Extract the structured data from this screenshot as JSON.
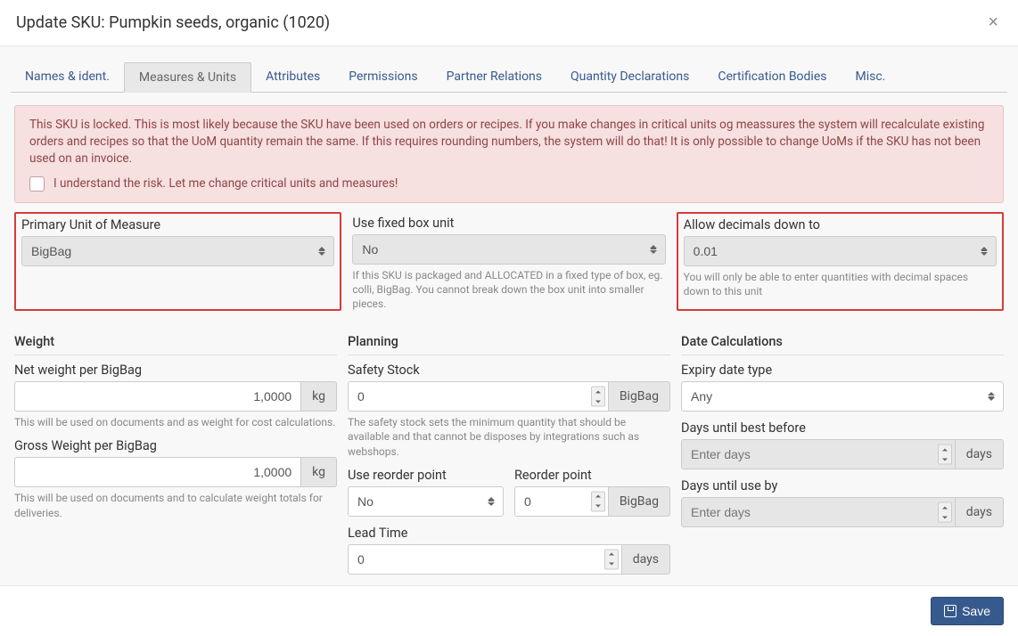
{
  "header": {
    "title": "Update SKU: Pumpkin seeds, organic (1020)"
  },
  "tabs": [
    "Names & ident.",
    "Measures & Units",
    "Attributes",
    "Permissions",
    "Partner Relations",
    "Quantity Declarations",
    "Certification Bodies",
    "Misc."
  ],
  "alert": {
    "text": "This SKU is locked. This is most likely because the SKU have been used on orders or recipes. If you make changes in critical units og meassures the system will recalculate existing orders and recipes so that the UoM quantity remain the same. If this requires rounding numbers, the system will do that! It is only possible to change UoMs if the SKU has not been used on an invoice.",
    "checkbox_label": "I understand the risk. Let me change critical units and measures!"
  },
  "primary_uom": {
    "label": "Primary Unit of Measure",
    "value": "BigBag"
  },
  "fixed_box": {
    "label": "Use fixed box unit",
    "value": "No",
    "hint": "If this SKU is packaged and ALLOCATED in a fixed type of box, eg. colli, BigBag. You cannot break down the box unit into smaller pieces."
  },
  "decimals": {
    "label": "Allow decimals down to",
    "value": "0.01",
    "hint": "You will only be able to enter quantities with decimal spaces down to this unit"
  },
  "weight": {
    "section": "Weight",
    "net_label": "Net weight per BigBag",
    "net_value": "1,0000",
    "net_unit": "kg",
    "net_hint": "This will be used on documents and as weight for cost calculations.",
    "gross_label": "Gross Weight per BigBag",
    "gross_value": "1,0000",
    "gross_unit": "kg",
    "gross_hint": "This will be used on documents and to calculate weight totals for deliveries."
  },
  "planning": {
    "section": "Planning",
    "safety_label": "Safety Stock",
    "safety_value": "0",
    "safety_unit": "BigBag",
    "safety_hint": "The safety stock sets the minimum quantity that should be available and that cannot be disposes by integrations such as webshops.",
    "use_reorder_label": "Use reorder point",
    "use_reorder_value": "No",
    "reorder_label": "Reorder point",
    "reorder_value": "0",
    "reorder_unit": "BigBag",
    "lead_label": "Lead Time",
    "lead_value": "0",
    "lead_unit": "days"
  },
  "dates": {
    "section": "Date Calculations",
    "expiry_label": "Expiry date type",
    "expiry_value": "Any",
    "best_label": "Days until best before",
    "best_placeholder": "Enter days",
    "best_unit": "days",
    "useby_label": "Days until use by",
    "useby_placeholder": "Enter days",
    "useby_unit": "days"
  },
  "footer": {
    "save": "Save"
  }
}
